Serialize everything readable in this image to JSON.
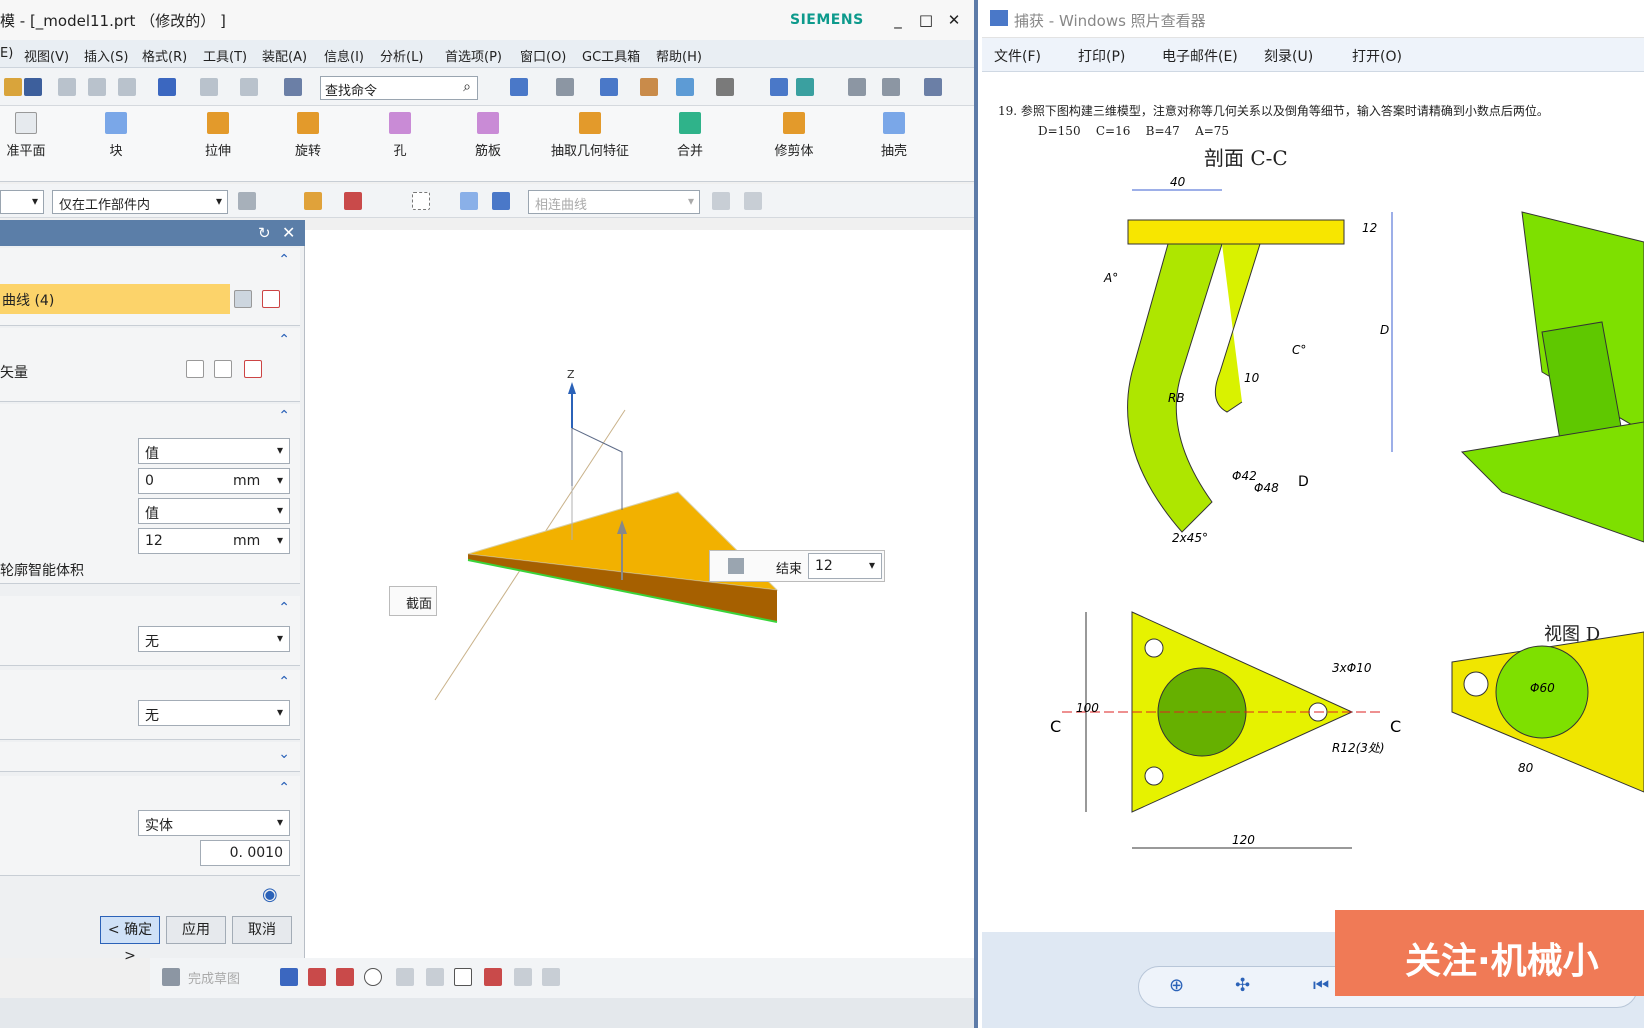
{
  "nx": {
    "title": "模 - [_model11.prt （修改的） ]",
    "brand": "SIEMENS",
    "window_controls": [
      "_",
      "□",
      "✕"
    ],
    "menu": [
      "E)",
      "视图(V)",
      "插入(S)",
      "格式(R)",
      "工具(T)",
      "装配(A)",
      "信息(I)",
      "分析(L)",
      "首选项(P)",
      "窗口(O)",
      "GC工具箱",
      "帮助(H)"
    ],
    "search_placeholder": "查找命令",
    "ribbon": [
      "准平面",
      "块",
      "拉伸",
      "旋转",
      "孔",
      "筋板",
      "抽取几何特征",
      "合并",
      "修剪体",
      "抽壳"
    ],
    "filter_scope": "仅在工作部件内",
    "curve_rule": "相连曲线",
    "dialog": {
      "section_curve": "曲线 (4)",
      "section_vector": "矢量",
      "start_type": "值",
      "start_value": "0",
      "start_unit": "mm",
      "end_type": "值",
      "end_value": "12",
      "end_unit": "mm",
      "smart_volume": "轮廓智能体积",
      "boolean": "无",
      "draft": "无",
      "body_type": "实体",
      "tolerance": "0. 0010",
      "ok": "< 确定 >",
      "apply": "应用",
      "cancel": "取消"
    },
    "viewport": {
      "axis_z": "Z",
      "section_label": "截面",
      "end_label": "结束",
      "end_value": "12"
    },
    "sketch_finish": "完成草图"
  },
  "viewer": {
    "title": "捕获 - Windows 照片查看器",
    "menu": [
      "文件(F)",
      "打印(P)",
      "电子邮件(E)",
      "刻录(U)",
      "打开(O)"
    ],
    "problem": "19. 参照下图构建三维模型，注意对称等几何关系以及倒角等细节，输入答案时请精确到小数点后两位。",
    "params": [
      "D=150",
      "C=16",
      "B=47",
      "A=75"
    ],
    "section_title": "剖面 C-C",
    "view_title": "视图 D",
    "dims": [
      "40",
      "12",
      "A°",
      "C°",
      "D",
      "RB",
      "10",
      "Φ42",
      "Φ48",
      "D",
      "2x45°",
      "100",
      "C",
      "C",
      "3xΦ10",
      "R12(3处)",
      "120",
      "Φ60",
      "80"
    ],
    "banner": "关注·机械小"
  },
  "colors": {
    "accent": "#5b7ea8",
    "siemens": "#0d9a8c",
    "part": "#f2b100",
    "model": "#7ee000",
    "banner": "#f07a56"
  }
}
